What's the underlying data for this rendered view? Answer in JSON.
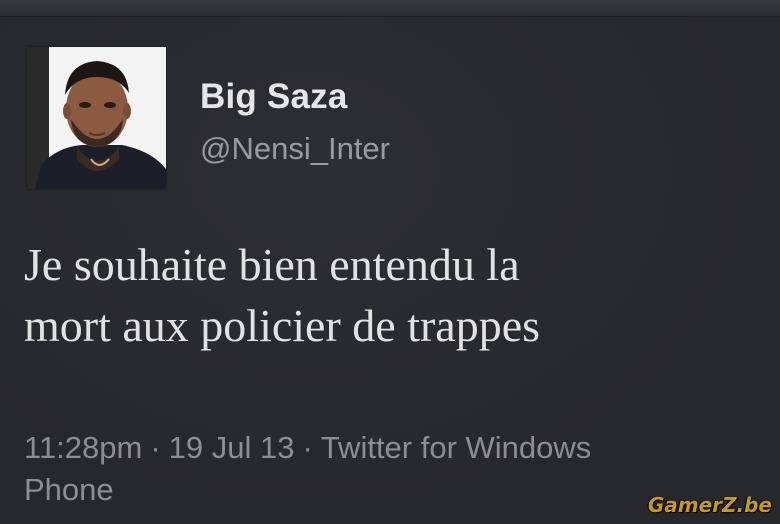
{
  "tweet": {
    "display_name": "Big Saza",
    "handle": "@Nensi_Inter",
    "text_line1": "Je souhaite bien entendu la",
    "text_line2": "mort aux policier de trappes",
    "time": "11:28pm",
    "separator": "·",
    "date": "19 Jul 13",
    "client_line1": "Twitter for Windows",
    "client_line2": "Phone"
  },
  "watermark": "GamerZ.be",
  "colors": {
    "background": "#292a2e",
    "name": "#e6e6e6",
    "handle": "#9a9b9f",
    "meta": "#8d8e92",
    "watermark": "#c79a1c"
  },
  "icons": {
    "avatar": "profile-photo"
  }
}
